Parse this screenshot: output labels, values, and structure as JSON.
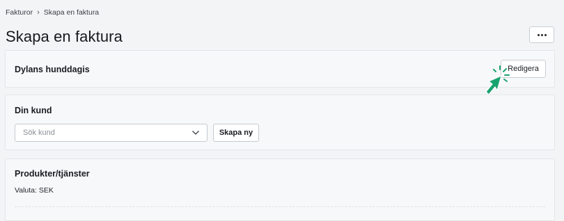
{
  "breadcrumb": {
    "items": [
      "Fakturor",
      "Skapa en faktura"
    ],
    "separator": "›"
  },
  "page": {
    "title": "Skapa en faktura",
    "more_icon": "more-horizontal-icon"
  },
  "sender": {
    "name": "Dylans hunddagis",
    "edit_label": "Redigera"
  },
  "customer": {
    "title": "Din kund",
    "search_placeholder": "Sök kund",
    "search_value": "",
    "create_label": "Skapa ny"
  },
  "products": {
    "title": "Produkter/tjänster",
    "currency": "Valuta: SEK"
  },
  "colors": {
    "background": "#f3f4f6",
    "cursor_accent": "#1aa36f"
  }
}
